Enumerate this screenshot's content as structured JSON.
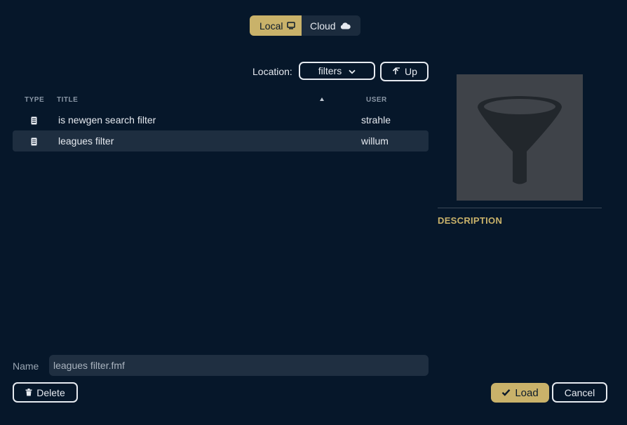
{
  "source_toggle": {
    "local_label": "Local",
    "cloud_label": "Cloud",
    "selected": "Local"
  },
  "location": {
    "label": "Location:",
    "value": "filters",
    "up_label": "Up"
  },
  "table": {
    "columns": {
      "type": "TYPE",
      "title": "TITLE",
      "user": "USER"
    },
    "sort": "title-ascending",
    "rows": [
      {
        "title": "is newgen search filter",
        "user": "strahle",
        "selected": false
      },
      {
        "title": "leagues filter",
        "user": "willum",
        "selected": true
      }
    ]
  },
  "preview": {
    "icon": "funnel-icon",
    "description_label": "DESCRIPTION"
  },
  "name_field": {
    "label": "Name",
    "value": "leagues filter.fmf"
  },
  "buttons": {
    "delete_label": "Delete",
    "load_label": "Load",
    "cancel_label": "Cancel"
  },
  "colors": {
    "background": "#06172a",
    "accent": "#c9b26a",
    "selected_row": "#1e2e40"
  }
}
